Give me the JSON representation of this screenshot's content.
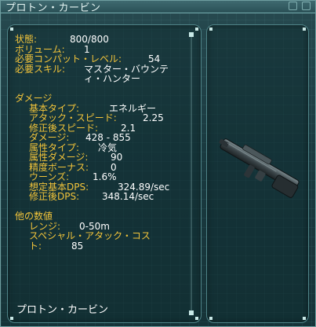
{
  "window": {
    "title": "プロトン・カービン"
  },
  "info": {
    "status_label": "状態:",
    "status_value": "800/800",
    "volume_label": "ボリューム:",
    "volume_value": "1",
    "compat_label": "必要コンパット・レベル:",
    "compat_value": "54",
    "skill_label": "必要スキル:",
    "skill_value_1": "マスター・バウンテ",
    "skill_value_2": "ィ・ハンター",
    "damage_header": "ダメージ",
    "base_type_label": "基本タイプ:",
    "base_type_value": "エネルギー",
    "attack_speed_label": "アタック・スピード:",
    "attack_speed_value": "2.25",
    "mod_speed_label": "修正後スピード:",
    "mod_speed_value": "2.1",
    "damage_label": "ダメージ:",
    "damage_value": "428 - 855",
    "attr_type_label": "属性タイプ:",
    "attr_type_value": "冷気",
    "attr_damage_label": "属性ダメージ:",
    "attr_damage_value": "90",
    "accuracy_label": "精度ボーナス:",
    "accuracy_value": "0",
    "wounds_label": "ウーンズ:",
    "wounds_value": "1.6%",
    "base_dps_label": "想定基本DPS:",
    "base_dps_value": "324.89/sec",
    "mod_dps_label": "修正後DPS:",
    "mod_dps_value": "348.14/sec",
    "other_header": "他の数値",
    "range_label": "レンジ:",
    "range_value": "0-50m",
    "special_label_1": "スペシャル・アタック・コス",
    "special_label_2": "ト:",
    "special_value": "85"
  },
  "footer_name": "プロトン・カービン",
  "colors": {
    "label": "#f2c43a",
    "value": "#ffffff",
    "panel_border": "#4f8488"
  },
  "icons": [
    "minimize-icon",
    "close-icon",
    "weapon-carbine-image"
  ]
}
